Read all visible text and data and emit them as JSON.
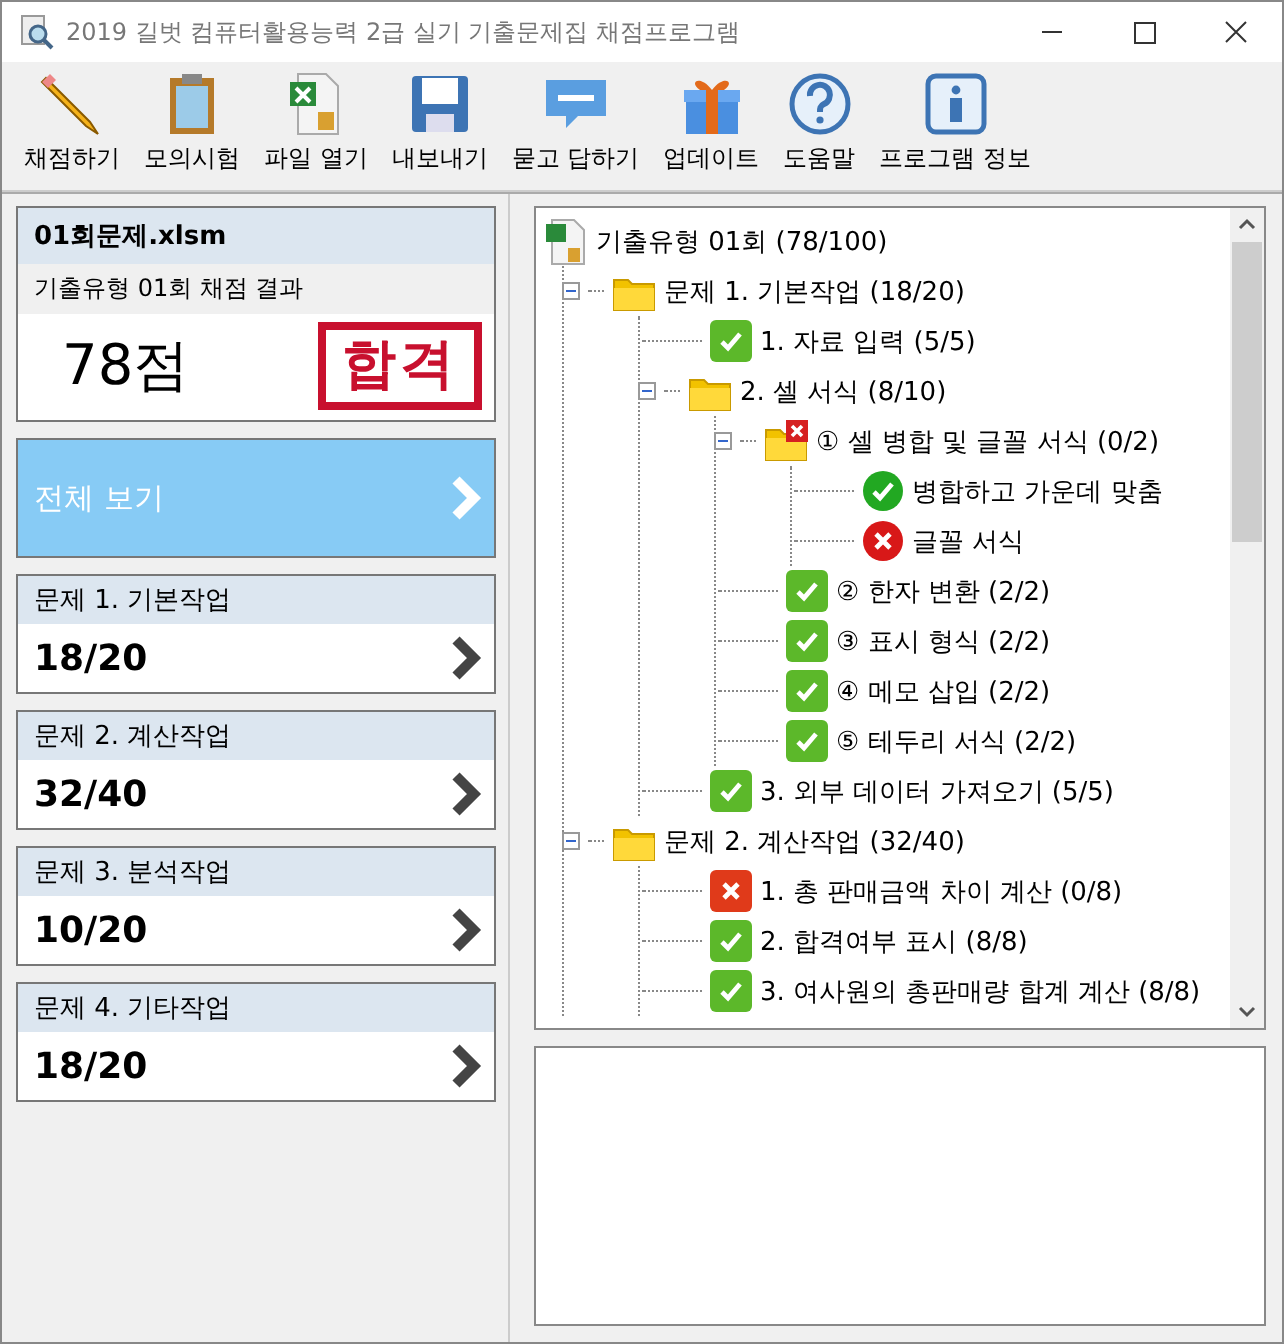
{
  "window": {
    "title": "2019 길벗 컴퓨터활용능력 2급 실기 기출문제집 채점프로그램"
  },
  "toolbar": [
    {
      "kind": "pencil",
      "label": "채점하기"
    },
    {
      "kind": "clipboard",
      "label": "모의시험"
    },
    {
      "kind": "excel",
      "label": "파일 열기"
    },
    {
      "kind": "disk",
      "label": "내보내기"
    },
    {
      "kind": "qa",
      "label": "묻고 답하기"
    },
    {
      "kind": "gift",
      "label": "업데이트"
    },
    {
      "kind": "help",
      "label": "도움말"
    },
    {
      "kind": "info",
      "label": "프로그램 정보"
    }
  ],
  "result": {
    "file": "01회문제.xlsm",
    "subtitle": "기출유형 01회 채점 결과",
    "score": "78점",
    "stamp": "합격"
  },
  "view_all": {
    "label": "전체 보기"
  },
  "sections": [
    {
      "title": "문제 1. 기본작업",
      "score": "18/20"
    },
    {
      "title": "문제 2. 계산작업",
      "score": "32/40"
    },
    {
      "title": "문제 3. 분석작업",
      "score": "10/20"
    },
    {
      "title": "문제 4. 기타작업",
      "score": "18/20"
    }
  ],
  "tree": {
    "label": "기출유형 01회 (78/100)",
    "children": [
      {
        "kind": "folder",
        "label": "문제 1. 기본작업 (18/20)",
        "expanded": true,
        "passed": true,
        "children": [
          {
            "kind": "result",
            "label": "1. 자료 입력 (5/5)",
            "passed": true
          },
          {
            "kind": "folder",
            "label": "2. 셀 서식 (8/10)",
            "expanded": true,
            "passed": true,
            "children": [
              {
                "kind": "folder",
                "label": "① 셀 병합 및 글꼴 서식 (0/2)",
                "expanded": true,
                "passed": false,
                "children": [
                  {
                    "kind": "criterion",
                    "label": "병합하고 가운데 맞춤",
                    "passed": true
                  },
                  {
                    "kind": "criterion",
                    "label": "글꼴 서식",
                    "passed": false
                  }
                ]
              },
              {
                "kind": "result",
                "label": "② 한자 변환 (2/2)",
                "passed": true
              },
              {
                "kind": "result",
                "label": "③ 표시 형식 (2/2)",
                "passed": true
              },
              {
                "kind": "result",
                "label": "④ 메모 삽입 (2/2)",
                "passed": true
              },
              {
                "kind": "result",
                "label": "⑤ 테두리 서식 (2/2)",
                "passed": true
              }
            ]
          },
          {
            "kind": "result",
            "label": "3. 외부 데이터 가져오기 (5/5)",
            "passed": true
          }
        ]
      },
      {
        "kind": "folder",
        "label": "문제 2. 계산작업 (32/40)",
        "expanded": true,
        "passed": true,
        "children": [
          {
            "kind": "result",
            "label": "1. 총 판매금액 차이 계산 (0/8)",
            "passed": false
          },
          {
            "kind": "result",
            "label": "2. 합격여부 표시 (8/8)",
            "passed": true
          },
          {
            "kind": "result",
            "label": "3. 여사원의 총판매량 합계 계산 (8/8)",
            "passed": true
          }
        ]
      }
    ]
  }
}
